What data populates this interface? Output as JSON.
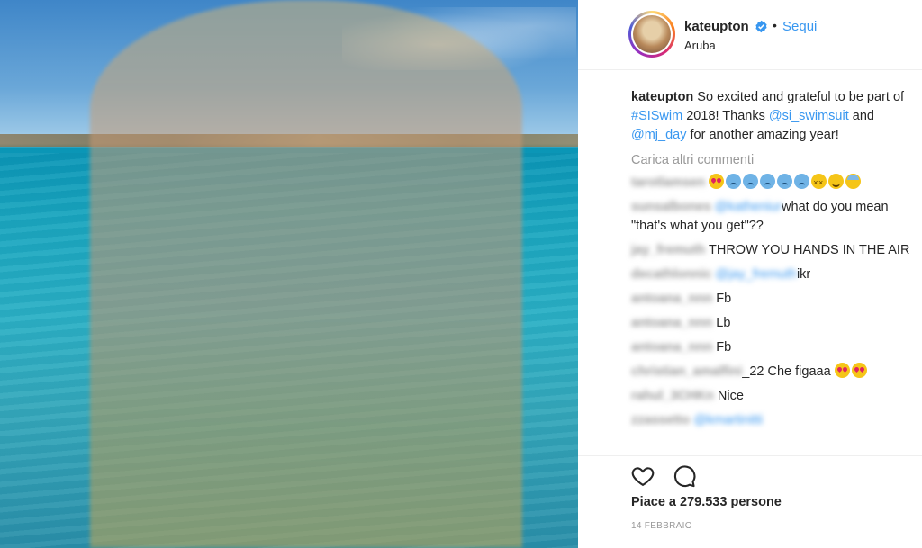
{
  "post": {
    "username": "kateupton",
    "follow_label": "Sequi",
    "dot": "•",
    "location": "Aruba"
  },
  "caption": {
    "username": "kateupton",
    "text_part1": " So excited and grateful to be part of ",
    "hashtag": "#SISwim",
    "text_part2": " 2018! Thanks ",
    "mention1": "@si_swimsuit",
    "text_part3": " and ",
    "mention2": "@mj_day",
    "text_part4": " for another amazing year!"
  },
  "load_more_label": "Carica altri commenti",
  "comments": [
    {
      "user": "tarotlamsen",
      "mention": "",
      "text": ""
    },
    {
      "user": "sunsalbones",
      "mention": "@katheniur",
      "text": "what do you mean \"that's what you get\"??"
    },
    {
      "user": "jay_fremuth",
      "mention": "",
      "text": "THROW YOU HANDS IN THE AIR"
    },
    {
      "user": "decathlonnic",
      "mention": "@jay_fremuth",
      "text": "ikr"
    },
    {
      "user": "antoana_nnn",
      "mention": "",
      "text": "Fb"
    },
    {
      "user": "antoana_nnn",
      "mention": "",
      "text": "Lb"
    },
    {
      "user": "antoana_nnn",
      "mention": "",
      "text": "Fb"
    },
    {
      "user": "christian_amalfini",
      "mention": "",
      "text": "_22 Che figaaa"
    },
    {
      "user": "rahul_3CHKn",
      "mention": "",
      "text": "Nice"
    },
    {
      "user": "zzassetto",
      "mention": "@kmartinitti",
      "text": ""
    }
  ],
  "likes_label": "Piace a 279.533 persone",
  "date_label": "14 FEBBRAIO",
  "colors": {
    "link": "#3897f0",
    "muted": "#999999",
    "text": "#262626"
  },
  "icons": [
    "verified-badge-icon",
    "heart-outline-icon",
    "comment-bubble-icon"
  ]
}
